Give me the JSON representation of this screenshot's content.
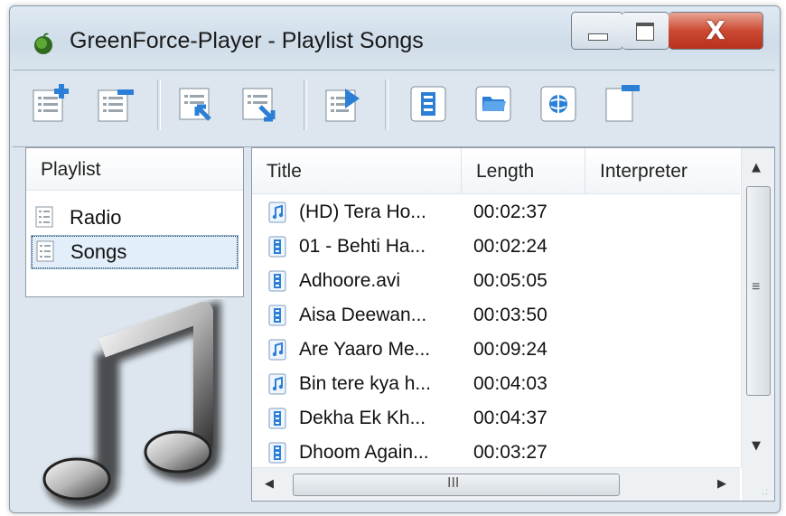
{
  "window": {
    "title": "GreenForce-Player - Playlist Songs",
    "close_glyph": "X"
  },
  "toolbar": {
    "buttons": [
      "playlist-add-icon",
      "playlist-remove-icon",
      "playlist-import-icon",
      "playlist-export-icon",
      "playlist-play-icon",
      "add-video-file-icon",
      "add-folder-icon",
      "add-url-icon",
      "remove-item-icon"
    ]
  },
  "playlists": {
    "header": "Playlist",
    "items": [
      {
        "label": "Radio",
        "selected": false
      },
      {
        "label": "Songs",
        "selected": true
      }
    ]
  },
  "songs": {
    "columns": [
      "Title",
      "Length",
      "Interpreter"
    ],
    "rows": [
      {
        "title": "(HD) Tera Ho...",
        "length": "00:02:37",
        "type": "audio"
      },
      {
        "title": "01 - Behti Ha...",
        "length": "00:02:24",
        "type": "video"
      },
      {
        "title": "Adhoore.avi",
        "length": "00:05:05",
        "type": "video"
      },
      {
        "title": "Aisa Deewan...",
        "length": "00:03:50",
        "type": "video"
      },
      {
        "title": "Are Yaaro Me...",
        "length": "00:09:24",
        "type": "audio"
      },
      {
        "title": "Bin tere kya h...",
        "length": "00:04:03",
        "type": "audio"
      },
      {
        "title": "Dekha Ek Kh...",
        "length": "00:04:37",
        "type": "video"
      },
      {
        "title": "Dhoom Again...",
        "length": "00:03:27",
        "type": "video"
      }
    ]
  },
  "scroll": {
    "vgrip": "≡",
    "hgrip": "III"
  },
  "colors": {
    "accent": "#2b7fd6",
    "selection": "#e2eef9"
  }
}
